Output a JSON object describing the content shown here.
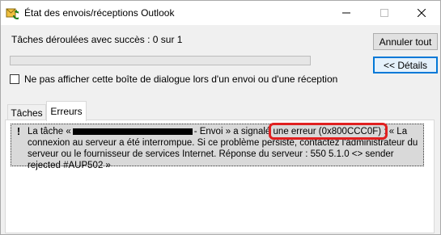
{
  "window": {
    "title": "État des envois/réceptions Outlook"
  },
  "status": {
    "text": "Tâches déroulées avec succès : 0 sur 1",
    "progress_fraction": 0
  },
  "buttons": {
    "cancel_all": "Annuler tout",
    "details": "<< Détails"
  },
  "checkbox": {
    "label": "Ne pas afficher cette boîte de dialogue lors d'un envoi ou d'une réception",
    "checked": false
  },
  "tabs": [
    {
      "label": "Tâches",
      "active": false
    },
    {
      "label": "Erreurs",
      "active": true
    }
  ],
  "errors": {
    "message_part1": "La tâche «",
    "message_part2": "- Envoi » a signalé ",
    "message_highlight": "une erreur (0x800CCC0F)",
    "message_part3": " : « La connexion au serveur a été interrompue. Si ce problème persiste, contactez l'administrateur du serveur ou le fournisseur de services Internet.  Réponse du serveur : 550 5.1.0 <> sender rejected #AUP502 »"
  },
  "colors": {
    "progress_fill": "#06b025",
    "accent": "#0078d7",
    "highlight": "#e02020"
  }
}
